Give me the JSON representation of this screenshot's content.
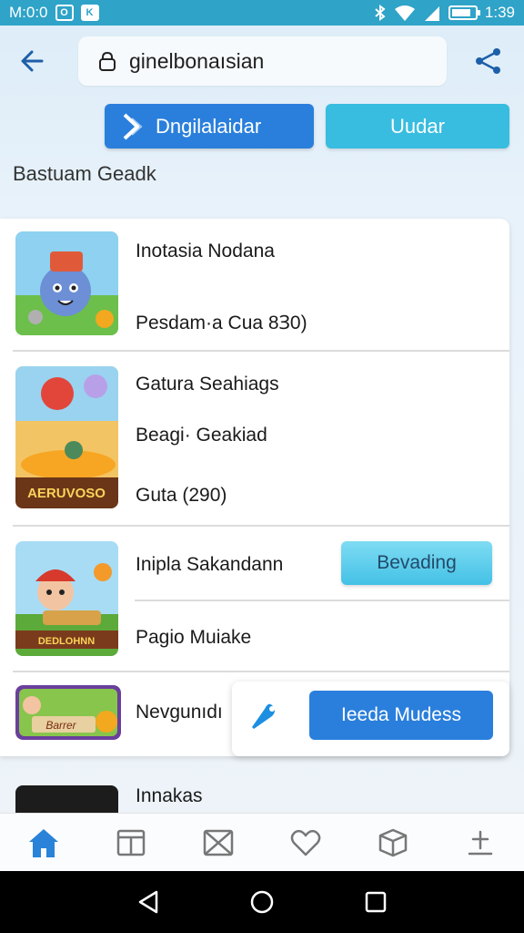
{
  "status_bar": {
    "time_left": "M:0:0",
    "time_right": "1:39",
    "badge_1": "O",
    "badge_2": "K"
  },
  "top_bar": {
    "search_value": "ginelbonaısian"
  },
  "buttons": {
    "primary_label": "Dngilalaidar",
    "secondary_label": "Uudar"
  },
  "section_title": "Bastuam Geadk",
  "list": {
    "item1": {
      "title": "Inotasia Nodana",
      "subtitle": "Pesdam·a Cua 8Ɜ0)"
    },
    "item2": {
      "title": "Gatura Seahiags",
      "subtitle": "Beagi· Geakiad",
      "meta": "Guta (290)",
      "thumb_label": "AERUVOSO"
    },
    "item3": {
      "title": "Inipla Sakandann",
      "subtitle": "Pagio Muiake",
      "button_label": "Bevading",
      "thumb_label": "DEDLOHNN"
    },
    "item4": {
      "title": "Nevgunıdı",
      "thumb_label": "Barrer"
    },
    "item5": {
      "title": "Innakas"
    }
  },
  "popup": {
    "button_label": "Ieeda Mudess"
  },
  "colors": {
    "accent_blue": "#2a7fdc",
    "accent_cyan": "#38bde0",
    "status_bar": "#2fa3c8"
  }
}
